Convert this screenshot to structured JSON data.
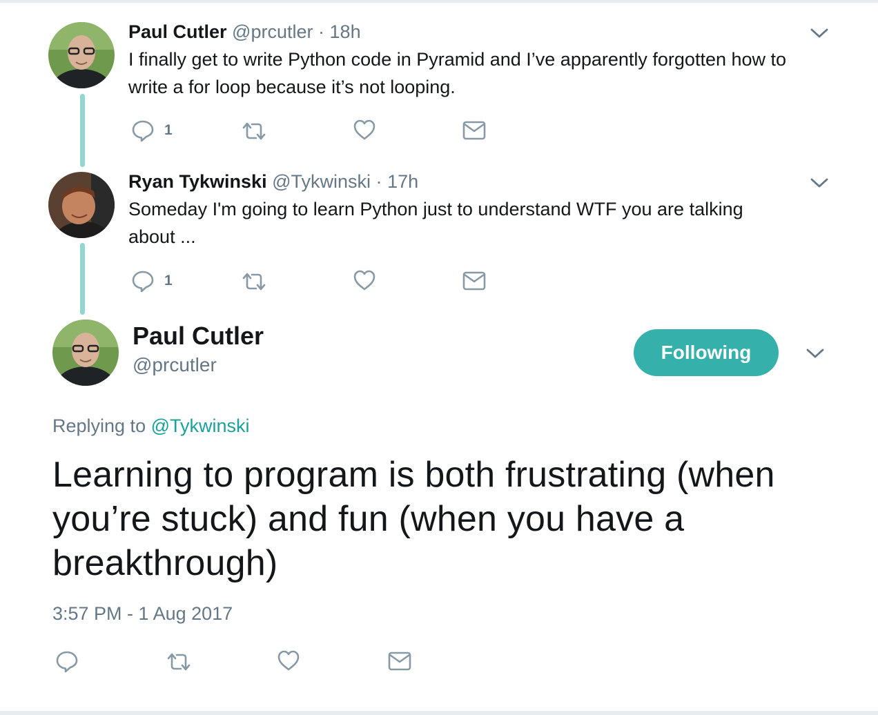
{
  "thread": [
    {
      "author_name": "Paul Cutler",
      "handle": "@prcutler",
      "separator": "·",
      "time": "18h",
      "text": "I finally get to write Python code in Pyramid and I’ve apparently forgotten how to write a for loop because it’s not looping.",
      "reply_count": "1"
    },
    {
      "author_name": "Ryan Tykwinski",
      "handle": "@Tykwinski",
      "separator": "·",
      "time": "17h",
      "text": "Someday I'm going to learn Python just to understand WTF you are talking about ...",
      "reply_count": "1"
    }
  ],
  "main_tweet": {
    "author_name": "Paul Cutler",
    "handle": "@prcutler",
    "follow_label": "Following",
    "replying_prefix": "Replying to",
    "replying_to": "@Tykwinski",
    "text": "Learning to program is both frustrating (when you’re stuck) and fun (when you have a breakthrough)",
    "timestamp": "3:57 PM - 1 Aug 2017"
  },
  "icons": {
    "reply": "reply-icon",
    "retweet": "retweet-icon",
    "like": "heart-icon",
    "dm": "envelope-icon",
    "menu": "chevron-down-icon"
  },
  "colors": {
    "accent": "#36b0ab",
    "mention": "#1aa19a",
    "thread_line": "#93d5d1",
    "secondary_text": "#657786",
    "icon_gray": "#8899a6"
  }
}
